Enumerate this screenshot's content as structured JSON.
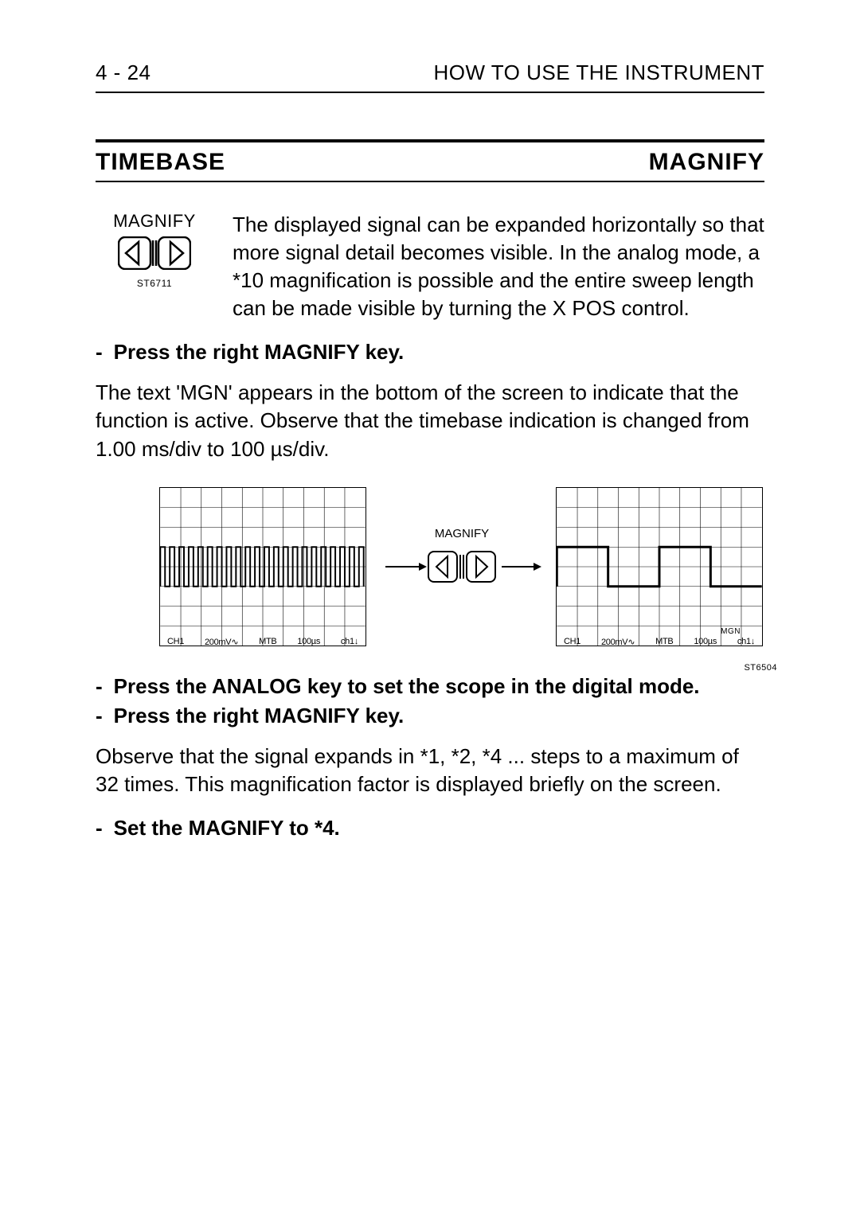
{
  "header": {
    "page_number": "4 - 24",
    "chapter_title": "HOW TO USE THE INSTRUMENT"
  },
  "section": {
    "left_title": "TIMEBASE",
    "right_title": "MAGNIFY"
  },
  "key_figure": {
    "label": "MAGNIFY",
    "ref": "ST6711"
  },
  "intro_paragraph": "The displayed signal can be expanded horizontally so that more signal detail becomes visible. In the analog mode, a *10 magnification is possible and the entire sweep length can be made visible by turning the X POS control.",
  "steps_1": [
    "Press the right MAGNIFY key."
  ],
  "after_step1_paragraph": "The text 'MGN' appears in the bottom of the screen to indicate that the function is active. Observe that the timebase indication is changed from 1.00 ms/div to 100 µs/div.",
  "scope": {
    "mid_label": "MAGNIFY",
    "left_readout": {
      "ch": "CH1",
      "vdiv": "200mV∿",
      "mtb": "MTB",
      "tdiv": "100µs",
      "extra": "ch1↓"
    },
    "right_readout": {
      "ch": "CH1",
      "vdiv": "200mV∿",
      "mtb": "MTB",
      "tdiv": "100µs",
      "mgn": "MGN",
      "extra": "ch1↓"
    },
    "ref": "ST6504"
  },
  "steps_2": [
    "Press the ANALOG key to set the scope in the digital mode.",
    "Press the right MAGNIFY key."
  ],
  "after_step2_paragraph": "Observe that the signal expands in *1, *2, *4 ... steps to a maximum of 32 times. This magnification factor is displayed briefly on the screen.",
  "steps_3": [
    "Set the MAGNIFY to *4."
  ]
}
